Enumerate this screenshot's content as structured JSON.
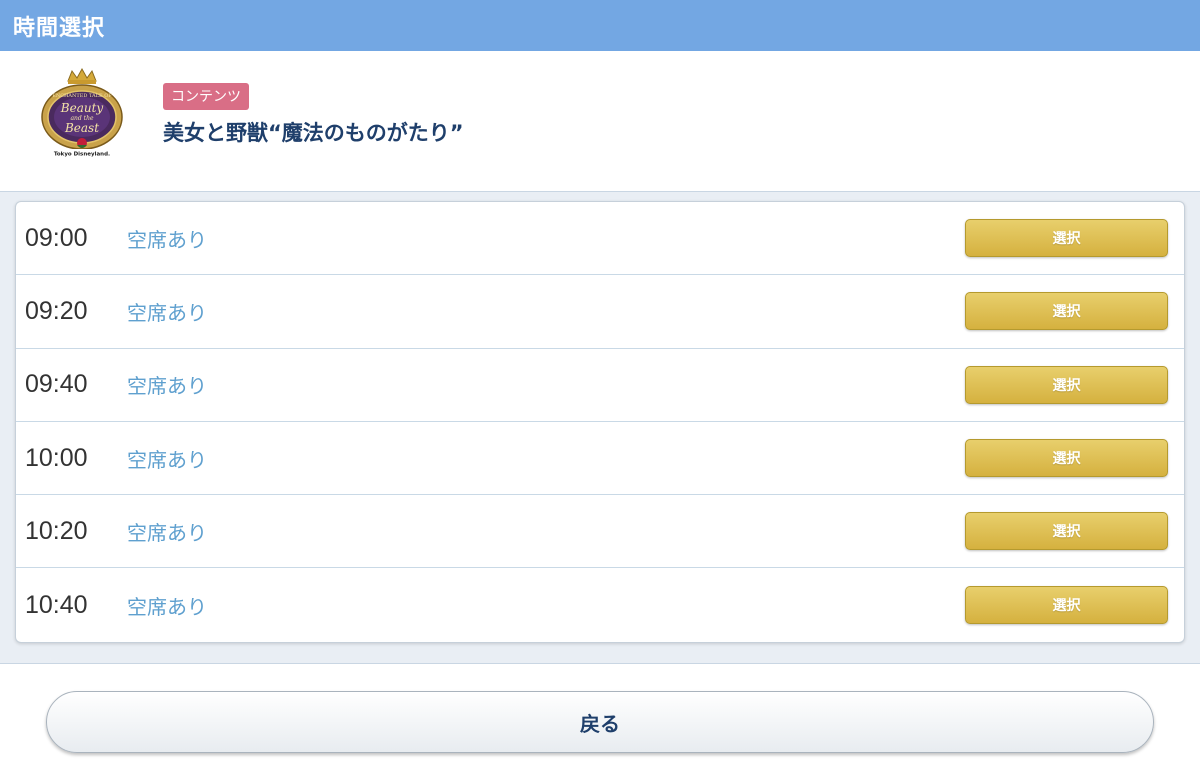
{
  "header": {
    "title": "時間選択"
  },
  "content": {
    "badge": "コンテンツ",
    "title": "美女と野獣“魔法のものがたり”",
    "logo": {
      "icon": "beauty-and-the-beast-logo",
      "line1": "ENCHANTED TALE OF",
      "line2": "Beauty",
      "line3": "and the",
      "line4": "Beast",
      "line5": "Tokyo Disneyland."
    }
  },
  "slots": [
    {
      "time": "09:00",
      "status": "空席あり",
      "button": "選択"
    },
    {
      "time": "09:20",
      "status": "空席あり",
      "button": "選択"
    },
    {
      "time": "09:40",
      "status": "空席あり",
      "button": "選択"
    },
    {
      "time": "10:00",
      "status": "空席あり",
      "button": "選択"
    },
    {
      "time": "10:20",
      "status": "空席あり",
      "button": "選択"
    },
    {
      "time": "10:40",
      "status": "空席あり",
      "button": "選択"
    }
  ],
  "footer": {
    "back_label": "戻る"
  },
  "colors": {
    "header": "#73a7e3",
    "badge": "#d96e86",
    "title": "#1f3f6b",
    "status": "#5fa0cf",
    "select_button": "#d5b13f"
  }
}
